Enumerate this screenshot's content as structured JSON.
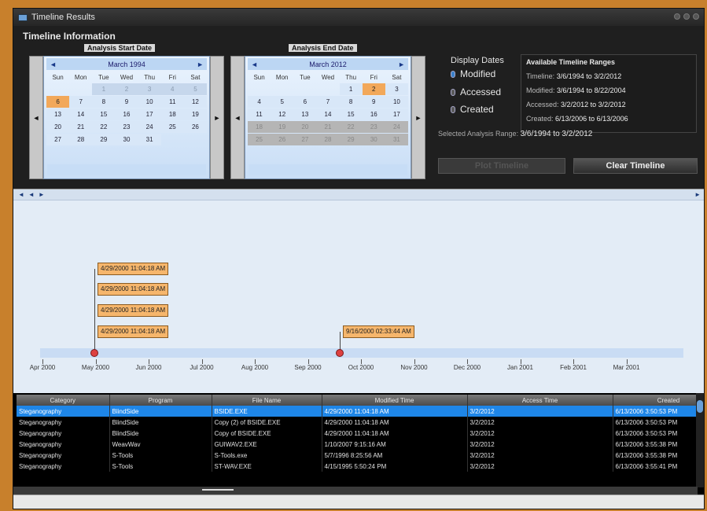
{
  "window": {
    "title": "Timeline Results"
  },
  "section_title": "Timeline Information",
  "start_cal": {
    "caption": "Analysis Start Date",
    "month": "March 1994",
    "dow": [
      "Sun",
      "Mon",
      "Tue",
      "Wed",
      "Thu",
      "Fri",
      "Sat"
    ],
    "rows": [
      [
        "",
        "",
        "1",
        "2",
        "3",
        "4",
        "5"
      ],
      [
        "6",
        "7",
        "8",
        "9",
        "10",
        "11",
        "12"
      ],
      [
        "13",
        "14",
        "15",
        "16",
        "17",
        "18",
        "19"
      ],
      [
        "20",
        "21",
        "22",
        "23",
        "24",
        "25",
        "26"
      ],
      [
        "27",
        "28",
        "29",
        "30",
        "31",
        "",
        ""
      ]
    ],
    "selected": "6"
  },
  "end_cal": {
    "caption": "Analysis End Date",
    "month": "March 2012",
    "dow": [
      "Sun",
      "Mon",
      "Tue",
      "Wed",
      "Thu",
      "Fri",
      "Sat"
    ],
    "rows": [
      [
        "",
        "",
        "",
        "",
        "1",
        "2",
        "3"
      ],
      [
        "4",
        "5",
        "6",
        "7",
        "8",
        "9",
        "10"
      ],
      [
        "11",
        "12",
        "13",
        "14",
        "15",
        "16",
        "17"
      ],
      [
        "18",
        "19",
        "20",
        "21",
        "22",
        "23",
        "24"
      ],
      [
        "25",
        "26",
        "27",
        "28",
        "29",
        "30",
        "31"
      ]
    ],
    "selected": "2"
  },
  "display_dates": {
    "title": "Display Dates",
    "options": [
      "Modified",
      "Accessed",
      "Created"
    ],
    "selected": "Modified"
  },
  "ranges": {
    "title": "Available Timeline Ranges",
    "lines": [
      {
        "label": "Timeline:",
        "value": "3/6/1994 to 3/2/2012"
      },
      {
        "label": "Modified:",
        "value": "3/6/1994 to 8/22/2004"
      },
      {
        "label": "Accessed:",
        "value": "3/2/2012 to 3/2/2012"
      },
      {
        "label": "Created:",
        "value": "6/13/2006 to 6/13/2006"
      }
    ]
  },
  "selected_range": {
    "label": "Selected Analysis Range:",
    "value": "3/6/1994 to 3/2/2012"
  },
  "buttons": {
    "plot": "Plot Timeline",
    "clear": "Clear Timeline"
  },
  "timeline": {
    "nav": [
      "◄",
      "◄",
      "►"
    ],
    "nav_right": "►",
    "events": [
      {
        "tags": [
          "4/29/2000 11:04:18 AM",
          "4/29/2000 11:04:18 AM",
          "4/29/2000 11:04:18 AM",
          "4/29/2000 11:04:18 AM"
        ]
      },
      {
        "tags": [
          "9/16/2000 02:33:44 AM"
        ]
      }
    ],
    "months": [
      "Apr 2000",
      "May 2000",
      "Jun 2000",
      "Jul 2000",
      "Aug 2000",
      "Sep 2000",
      "Oct 2000",
      "Nov 2000",
      "Dec 2000",
      "Jan 2001",
      "Feb 2001",
      "Mar 2001"
    ]
  },
  "table": {
    "columns": [
      "Category",
      "Program",
      "File Name",
      "Modified Time",
      "Access Time",
      "Created"
    ],
    "rows": [
      [
        "Steganography",
        "BlindSide",
        "BSIDE.EXE",
        "4/29/2000 11:04:18 AM",
        "3/2/2012",
        "6/13/2006 3:50:53 PM"
      ],
      [
        "Steganography",
        "BlindSide",
        "Copy (2) of BSIDE.EXE",
        "4/29/2000 11:04:18 AM",
        "3/2/2012",
        "6/13/2006 3:50:53 PM"
      ],
      [
        "Steganography",
        "BlindSide",
        "Copy of BSIDE.EXE",
        "4/29/2000 11:04:18 AM",
        "3/2/2012",
        "6/13/2006 3:50:53 PM"
      ],
      [
        "Steganography",
        "WeavWav",
        "GUIWAV2.EXE",
        "1/10/2007 9:15:16 AM",
        "3/2/2012",
        "6/13/2006 3:55:38 PM"
      ],
      [
        "Steganography",
        "S-Tools",
        "S-Tools.exe",
        "5/7/1996 8:25:56 AM",
        "3/2/2012",
        "6/13/2006 3:55:38 PM"
      ],
      [
        "Steganography",
        "S-Tools",
        "ST-WAV.EXE",
        "4/15/1995 5:50:24 PM",
        "3/2/2012",
        "6/13/2006 3:55:41 PM"
      ]
    ]
  }
}
